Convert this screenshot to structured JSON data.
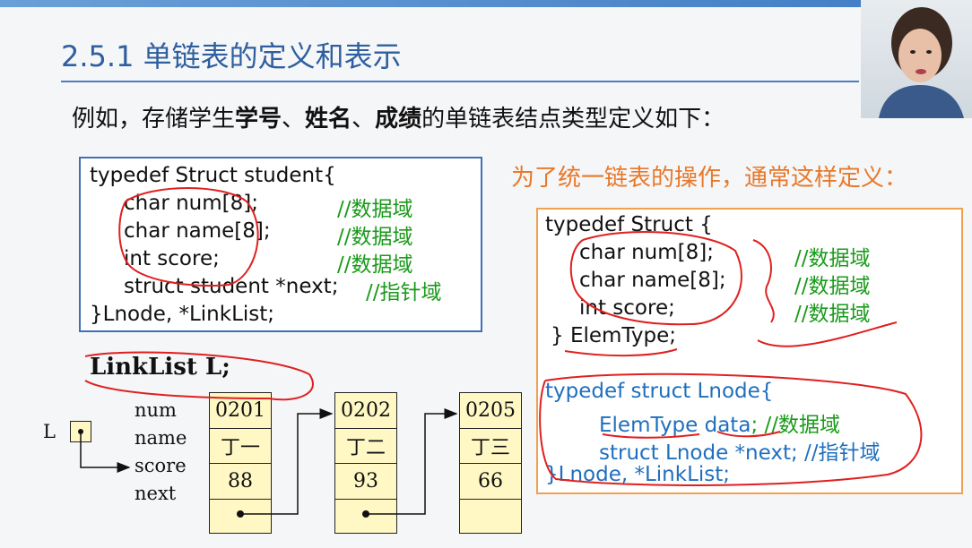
{
  "slide": {
    "title": "2.5.1 单链表的定义和表示",
    "intro": {
      "pre": "例如，存储学生",
      "b1": "学号",
      "sep1": "、",
      "b2": "姓名",
      "sep2": "、",
      "b3": "成绩",
      "post": "的单链表结点类型定义如下："
    },
    "note": "为了统一链表的操作，通常这样定义："
  },
  "code1": {
    "l1": "typedef Struct student{",
    "l2": "char num[8];",
    "l3": "char name[8];",
    "l4": "int score;",
    "l5": "struct student *next;",
    "l6": "}Lnode, *LinkList;",
    "c2": "//数据域",
    "c3": "//数据域",
    "c4": "//数据域",
    "c5": "//指针域"
  },
  "code2": {
    "l1": "typedef Struct {",
    "l2": "char num[8];",
    "l3": "char name[8];",
    "l4": "int score;",
    "l5": "} ElemType;",
    "c2": "//数据域",
    "c3": "//数据域",
    "c4": "//数据域",
    "m1": "typedef  struct  Lnode{",
    "m2a": "ElemType   data",
    "m2b": "; //数据域",
    "m3": "struct   Lnode  *next; //指针域",
    "m4": "}Lnode, *LinkList;"
  },
  "diagram": {
    "decl": "LinkList  L;",
    "head_label": "L",
    "field_labels": [
      "num",
      "name",
      "score",
      "next"
    ],
    "nodes": [
      {
        "num": "0201",
        "name": "丁一",
        "score": "88"
      },
      {
        "num": "0202",
        "name": "丁二",
        "score": "93"
      },
      {
        "num": "0205",
        "name": "丁三",
        "score": "66"
      }
    ]
  }
}
